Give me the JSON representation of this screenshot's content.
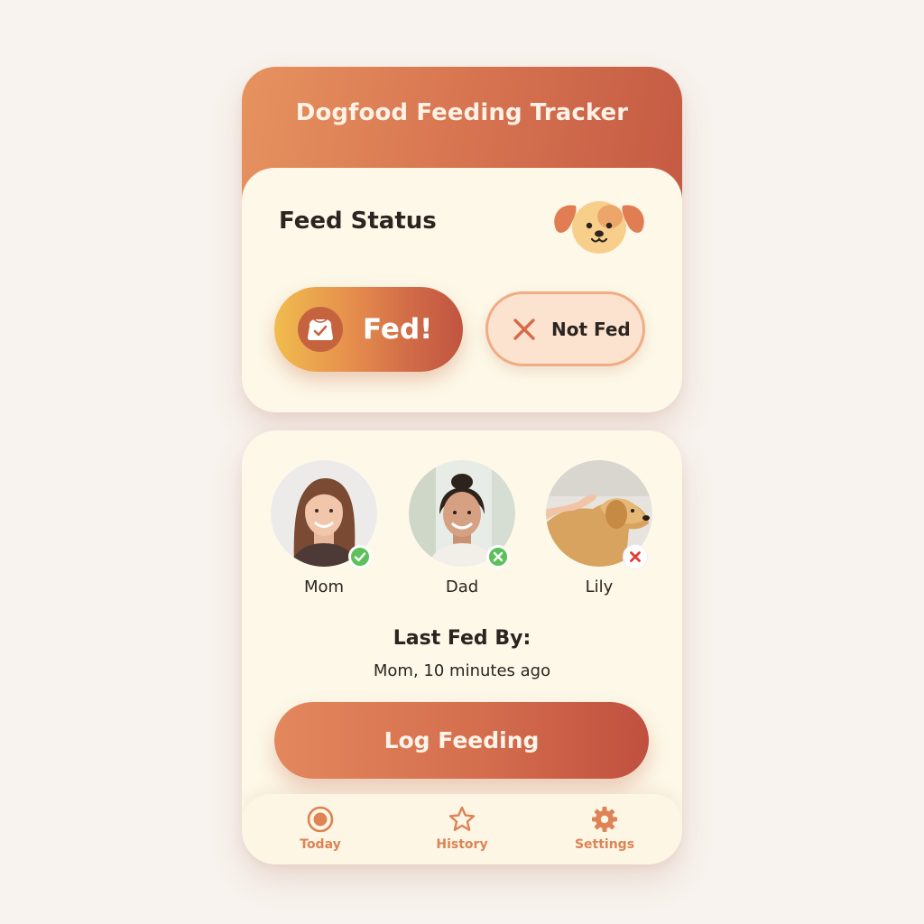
{
  "app": {
    "title": "Dogfood Feeding Tracker"
  },
  "status": {
    "title": "Feed Status",
    "mascot_icon": "dog-face-icon",
    "fed_button": {
      "label": "Fed!",
      "icon": "food-bowl-check-icon"
    },
    "not_fed_button": {
      "label": "Not Fed",
      "icon": "x-icon"
    }
  },
  "family": {
    "members": [
      {
        "name": "Mom",
        "status": "fed",
        "badge_icon": "check-icon",
        "badge_color": "#5cc15b"
      },
      {
        "name": "Dad",
        "status": "fed",
        "badge_icon": "x-circle-icon",
        "badge_color": "#5cc15b"
      },
      {
        "name": "Lily",
        "status": "not-fed",
        "badge_icon": "x-icon",
        "badge_color": "#e53935"
      }
    ]
  },
  "last_fed": {
    "title": "Last Fed By:",
    "value": "Mom, 10 minutes ago"
  },
  "actions": {
    "log_feeding": "Log Feeding"
  },
  "tabbar": {
    "tabs": [
      {
        "label": "Today",
        "icon": "target-icon",
        "active": true
      },
      {
        "label": "History",
        "icon": "star-icon",
        "active": false
      },
      {
        "label": "Settings",
        "icon": "gear-icon",
        "active": false
      }
    ]
  },
  "colors": {
    "accent": "#d97752",
    "accent_dark": "#c45a43",
    "card": "#fdf8e8",
    "background": "#f8f3ee",
    "tab_label": "#dd8356"
  }
}
